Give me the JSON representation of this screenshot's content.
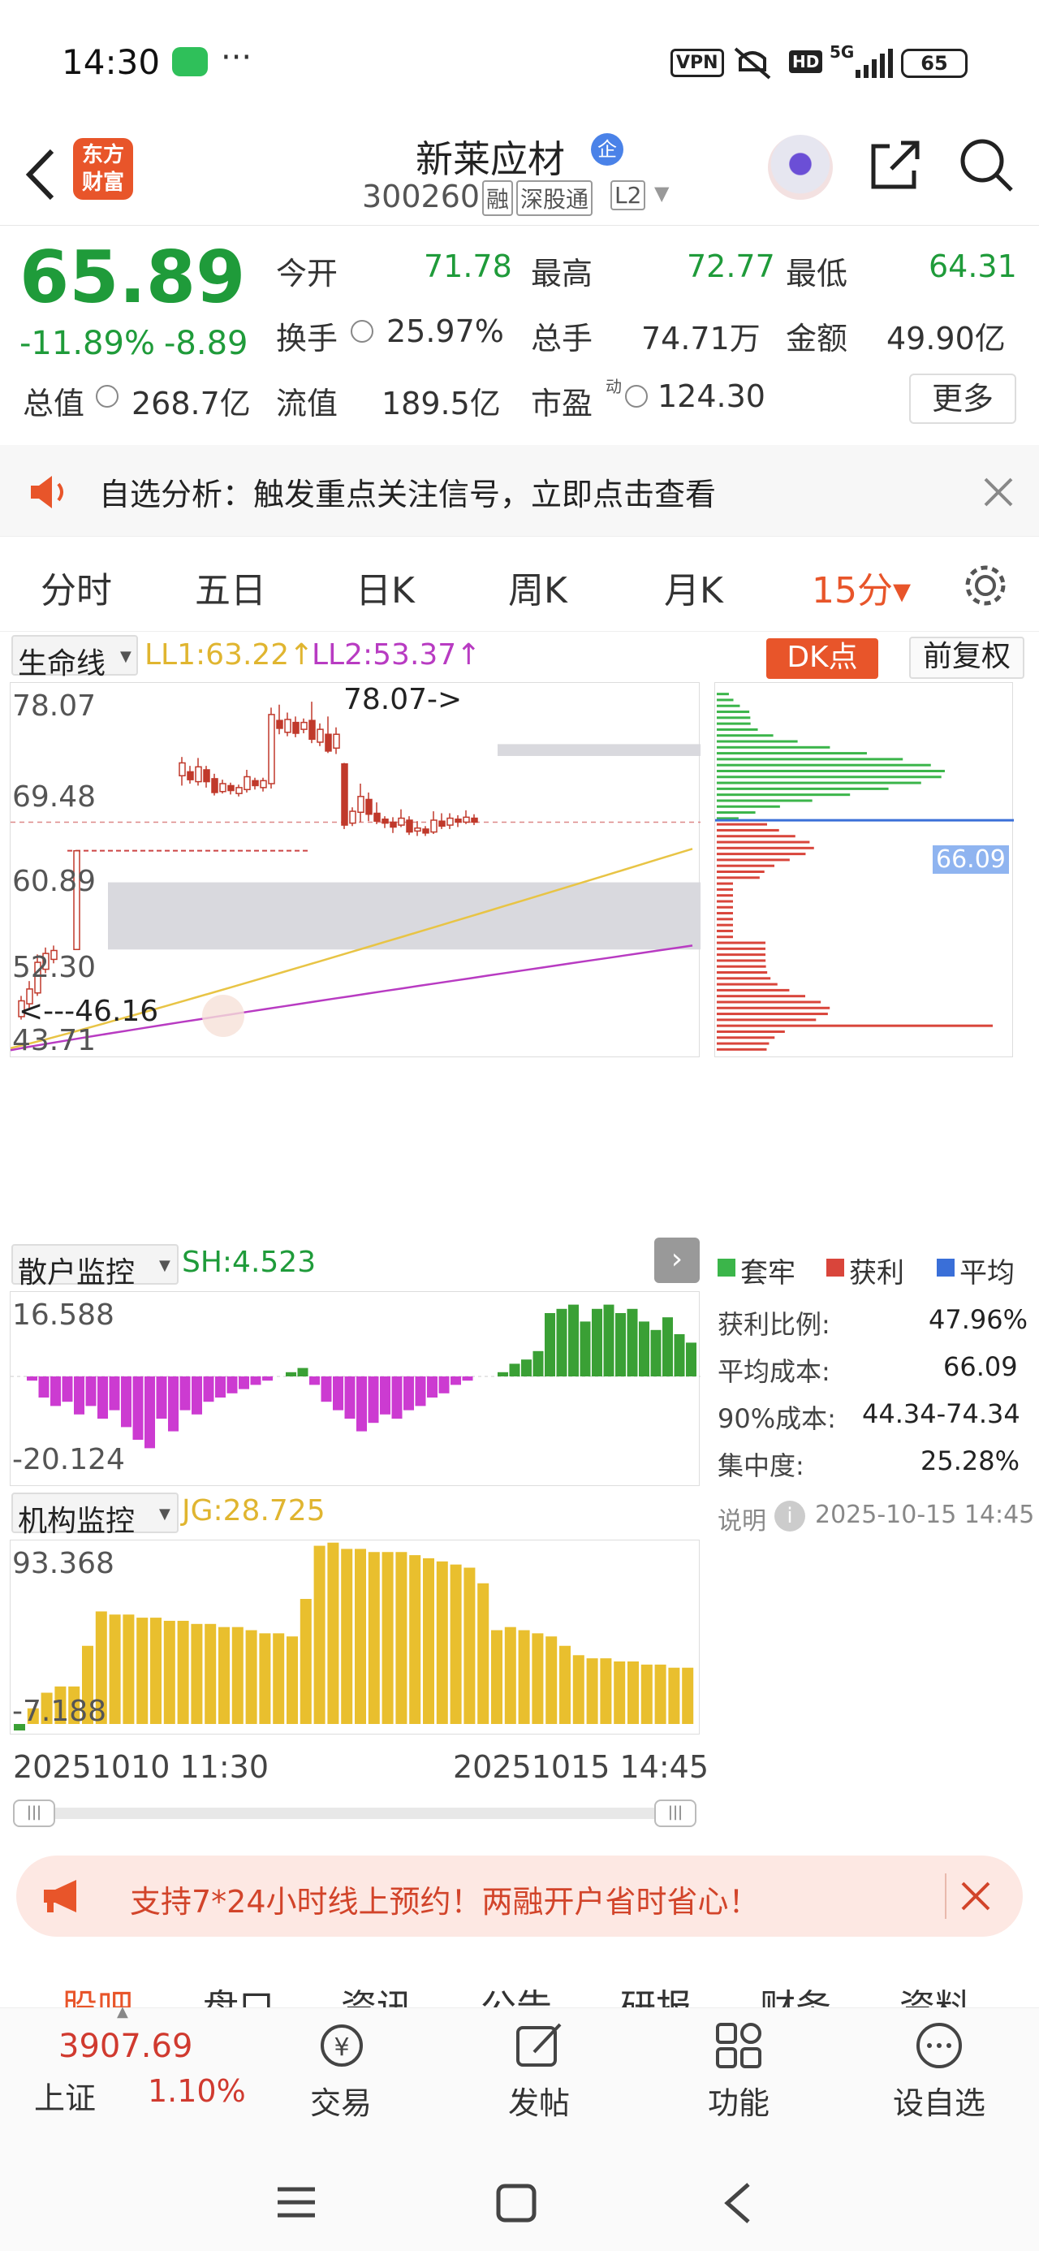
{
  "status": {
    "time": "14:30",
    "dots": "···",
    "vpn": "VPN",
    "hd": "HD",
    "net": "5G",
    "battery": "65"
  },
  "header": {
    "title": "新莱应材",
    "badge": "企",
    "code": "300260",
    "tags": [
      "融",
      "深股通",
      "L2"
    ],
    "logo_top": "东方",
    "logo_bottom": "财富"
  },
  "quote": {
    "price": "65.89",
    "change_pct": "-11.89%",
    "change": "-8.89",
    "stats": [
      {
        "label": "今开",
        "value": "71.78",
        "color": "#1f9b3a"
      },
      {
        "label": "最高",
        "value": "72.77",
        "color": "#1f9b3a"
      },
      {
        "label": "最低",
        "value": "64.31",
        "color": "#1f9b3a"
      },
      {
        "label": "换手",
        "value": "25.97%",
        "color": "#222"
      },
      {
        "label": "总手",
        "value": "74.71万",
        "color": "#222"
      },
      {
        "label": "金额",
        "value": "49.90亿",
        "color": "#222"
      },
      {
        "label": "总值",
        "value": "268.7亿",
        "color": "#222"
      },
      {
        "label": "流值",
        "value": "189.5亿",
        "color": "#222"
      },
      {
        "label": "市盈",
        "value": "124.30",
        "color": "#222"
      }
    ],
    "pe_sup": "动",
    "more": "更多"
  },
  "notice": {
    "text": "自选分析：触发重点关注信号，立即点击查看"
  },
  "tabs": [
    {
      "label": "分时"
    },
    {
      "label": "五日"
    },
    {
      "label": "日K"
    },
    {
      "label": "周K"
    },
    {
      "label": "月K"
    },
    {
      "label": "15分▾"
    }
  ],
  "chart": {
    "indicator": "生命线",
    "ll1": "LL1:63.22↑",
    "ll2": "LL2:53.37↑",
    "dk": "DK点",
    "fq": "前复权",
    "yticks": [
      "78.07",
      "69.48",
      "60.89",
      "52.30",
      "43.71"
    ],
    "high_mark": "78.07->",
    "low_mark": "<---46.16",
    "cost_price": "66.09",
    "retail": {
      "label": "散户监控",
      "sh": "SH:4.523",
      "top": "16.588",
      "bottom": "-20.124"
    },
    "inst": {
      "label": "机构监控",
      "jg": "JG:28.725",
      "top": "93.368",
      "bottom": "-7.188"
    },
    "date_start": "20251010 11:30",
    "date_end": "20251015 14:45",
    "legend": [
      {
        "label": "套牢",
        "color": "#3bb54a"
      },
      {
        "label": "获利",
        "color": "#d9453b"
      },
      {
        "label": "平均",
        "color": "#3a6fd8"
      }
    ],
    "stats": [
      {
        "label": "获利比例:",
        "value": "47.96%"
      },
      {
        "label": "平均成本:",
        "value": "66.09"
      },
      {
        "label": "90%成本:",
        "value": "44.34-74.34"
      },
      {
        "label": "集中度:",
        "value": "25.28%"
      }
    ],
    "note": "说明",
    "note_time": "2025-10-15 14:45"
  },
  "banner": {
    "text": "支持7*24小时线上预约！两融开户省时省心！"
  },
  "subtabs": [
    {
      "label": "股吧"
    },
    {
      "label": "盘口"
    },
    {
      "label": "资讯"
    },
    {
      "label": "公告"
    },
    {
      "label": "研报"
    },
    {
      "label": "财务"
    },
    {
      "label": "资料"
    }
  ],
  "bottom": {
    "index_value": "3907.69",
    "index_name": "上证",
    "index_pct": "1.10%",
    "items": [
      {
        "label": "交易"
      },
      {
        "label": "发帖"
      },
      {
        "label": "功能"
      },
      {
        "label": "设自选"
      }
    ]
  }
}
